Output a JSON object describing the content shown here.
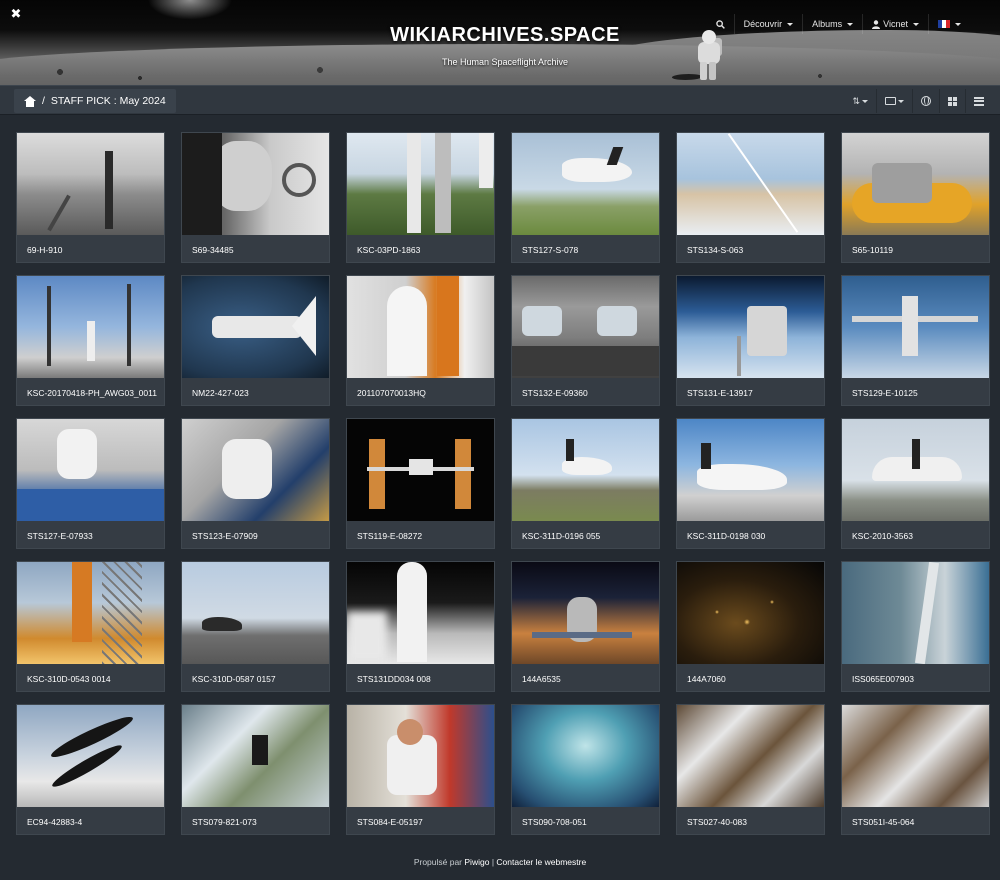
{
  "header": {
    "site_title": "WIKIARCHIVES.SPACE",
    "site_subtitle": "The Human Spaceflight Archive",
    "tools_icon": "tools-icon",
    "nav": {
      "search_icon": "search-icon",
      "discover_label": "Découvrir",
      "albums_label": "Albums",
      "user_label": "Vicnet",
      "language_flag": "flag-fr"
    }
  },
  "breadcrumb": {
    "home_icon": "home-icon",
    "separator": "/",
    "current": "STAFF PICK : May 2024"
  },
  "toolbar": {
    "sort_icon": "sort-icon",
    "photo_size_icon": "image-size-icon",
    "language_icon": "globe-icon",
    "grid_view_icon": "grid-icon",
    "list_view_icon": "list-icon"
  },
  "photos": [
    {
      "label": "69-H-910",
      "scene": "t-launchpad"
    },
    {
      "label": "S69-34485",
      "scene": "t-portrait"
    },
    {
      "label": "KSC-03PD-1863",
      "scene": "t-pad-green"
    },
    {
      "label": "STS127-S-078",
      "scene": "t-shuttle-land"
    },
    {
      "label": "STS134-S-063",
      "scene": "t-clouds"
    },
    {
      "label": "S65-10119",
      "scene": "t-hangar"
    },
    {
      "label": "KSC-20170418-PH_AWG03_0011",
      "scene": "t-launch-blue"
    },
    {
      "label": "NM22-427-023",
      "scene": "t-earth-shuttle"
    },
    {
      "label": "201107070013HQ",
      "scene": "t-stack"
    },
    {
      "label": "STS132-E-09360",
      "scene": "t-cockpit"
    },
    {
      "label": "STS131-E-13917",
      "scene": "t-iss-earth"
    },
    {
      "label": "STS129-E-10125",
      "scene": "t-iss-top"
    },
    {
      "label": "STS127-E-07933",
      "scene": "t-eva1"
    },
    {
      "label": "STS123-E-07909",
      "scene": "t-eva2"
    },
    {
      "label": "STS119-E-08272",
      "scene": "t-iss-black"
    },
    {
      "label": "KSC-311D-0196 055",
      "scene": "t-shuttle-runway"
    },
    {
      "label": "KSC-311D-0198 030",
      "scene": "t-shuttle-cloud"
    },
    {
      "label": "KSC-2010-3563",
      "scene": "t-shuttle-gear"
    },
    {
      "label": "KSC-310D-0543 0014",
      "scene": "t-srb-fire"
    },
    {
      "label": "KSC-310D-0587 0157",
      "scene": "t-runway-grey"
    },
    {
      "label": "STS131DD034 008",
      "scene": "t-night-pad"
    },
    {
      "label": "144A6535",
      "scene": "t-soyuz"
    },
    {
      "label": "144A7060",
      "scene": "t-night-earth"
    },
    {
      "label": "ISS065E007903",
      "scene": "t-coast"
    },
    {
      "label": "EC94-42883-4",
      "scene": "t-sr71"
    },
    {
      "label": "STS079-821-073",
      "scene": "t-mountains"
    },
    {
      "label": "STS084-E-05197",
      "scene": "t-interior"
    },
    {
      "label": "STS090-708-051",
      "scene": "t-ocean"
    },
    {
      "label": "STS027-40-083",
      "scene": "t-desert-snow"
    },
    {
      "label": "STS051I-45-064",
      "scene": "t-desert-snow2"
    }
  ],
  "footer": {
    "powered_by": "Propulsé par",
    "piwigo_link": "Piwigo",
    "separator": "|",
    "contact_link": "Contacter le webmestre"
  }
}
